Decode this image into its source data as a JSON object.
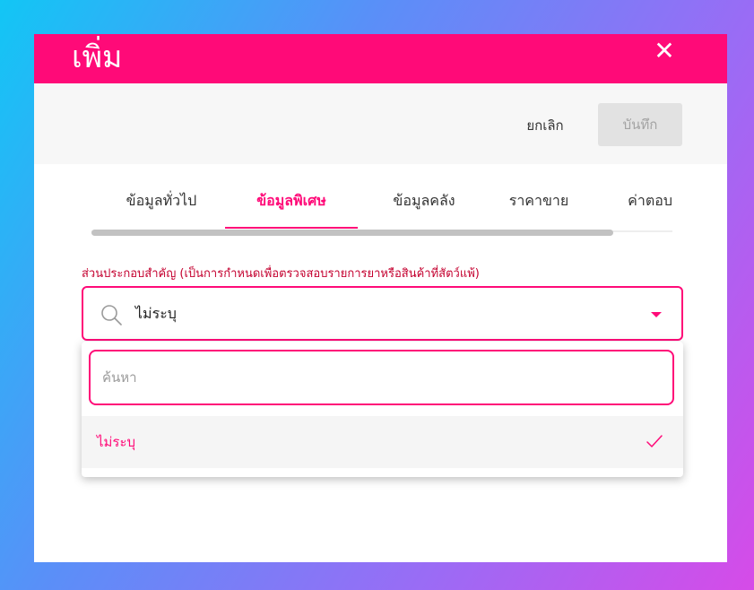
{
  "dialog": {
    "title": "เพิ่ม",
    "close_icon": "close-icon",
    "accent_color": "#ff0a78"
  },
  "actions": {
    "cancel_label": "ยกเลิก",
    "save_label": "บันทึก"
  },
  "tabs": [
    {
      "label": "ข้อมูลทั่วไป",
      "active": false
    },
    {
      "label": "ข้อมูลพิเศษ",
      "active": true
    },
    {
      "label": "ข้อมูลคลัง",
      "active": false
    },
    {
      "label": "ราคาขาย",
      "active": false
    },
    {
      "label": "ค่าตอบ",
      "active": false
    }
  ],
  "field": {
    "label": "ส่วนประกอบสำคัญ (เป็นการกำหนดเพื่อตรวจสอบรายการยาหรือสินค้าที่สัตว์แพ้)",
    "selected_value": "ไม่ระบุ",
    "icon": "search-icon"
  },
  "dropdown": {
    "search_placeholder": "ค้นหา",
    "options": [
      {
        "label": "ไม่ระบุ",
        "selected": true
      }
    ]
  }
}
